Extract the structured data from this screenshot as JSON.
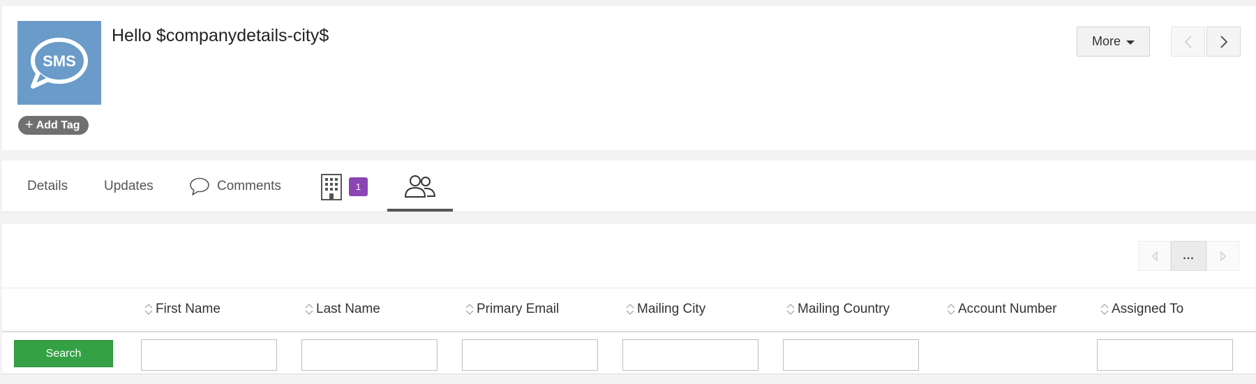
{
  "header": {
    "title": "Hello $companydetails-city$",
    "image_text": "SMS",
    "image_color": "#6a9bc9",
    "add_tag_label": "Add Tag",
    "more_label": "More"
  },
  "tabs": {
    "details": "Details",
    "updates": "Updates",
    "comments": "Comments",
    "organizations_count": "1",
    "badge_color": "#8b45b5",
    "active": "contacts"
  },
  "related_list": {
    "pager_label": "...",
    "columns": [
      {
        "label": "First Name",
        "has_filter": true
      },
      {
        "label": "Last Name",
        "has_filter": true
      },
      {
        "label": "Primary Email",
        "has_filter": true
      },
      {
        "label": "Mailing City",
        "has_filter": true
      },
      {
        "label": "Mailing Country",
        "has_filter": true
      },
      {
        "label": "Account Number",
        "has_filter": false
      },
      {
        "label": "Assigned To",
        "has_filter": true
      }
    ],
    "search_label": "Search",
    "search_color": "#34a244"
  }
}
